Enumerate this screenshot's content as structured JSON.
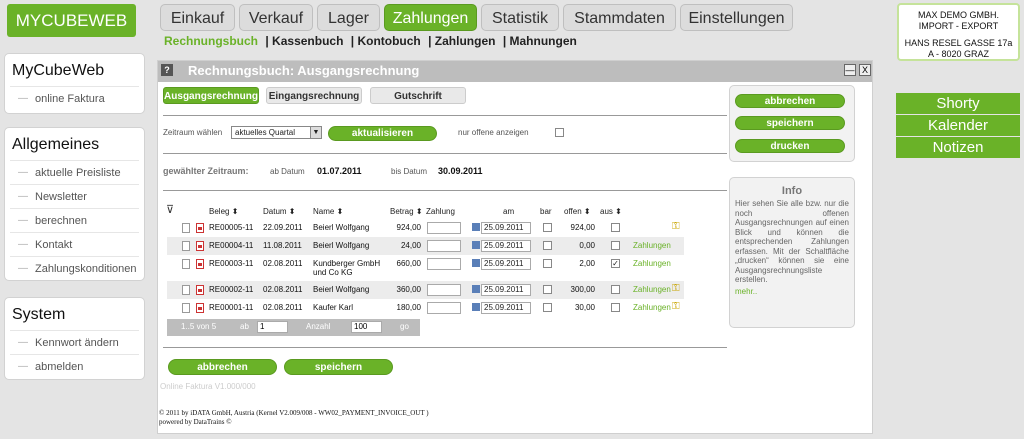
{
  "app": {
    "logo": "MYCUBEWEB"
  },
  "topnav": [
    "Einkauf",
    "Verkauf",
    "Lager",
    "Zahlungen",
    "Statistik",
    "Stammdaten",
    "Einstellungen"
  ],
  "subnav": [
    "Rechnungsbuch",
    "| Kassenbuch",
    "| Kontobuch",
    "| Zahlungen",
    "| Mahnungen"
  ],
  "sidebar": {
    "mycubeweb": {
      "title": "MyCubeWeb",
      "items": [
        "online Faktura"
      ]
    },
    "allgemeines": {
      "title": "Allgemeines",
      "items": [
        "aktuelle Preisliste",
        "Newsletter",
        "berechnen",
        "Kontakt",
        "Zahlungskonditionen"
      ]
    },
    "system": {
      "title": "System",
      "items": [
        "Kennwort ändern",
        "abmelden"
      ]
    }
  },
  "company": {
    "line1": "MAX DEMO GMBH.",
    "line2": "IMPORT - EXPORT",
    "line3": "HANS RESEL GASSE 17a",
    "line4": "A - 8020 GRAZ"
  },
  "rightnav": [
    "Shorty",
    "Kalender",
    "Notizen"
  ],
  "panel": {
    "icon": "?",
    "title": "Rechnungsbuch: Ausgangsrechnung",
    "min": "—",
    "close": "X",
    "tabs": [
      "Ausgangsrechnung",
      "Eingangsrechnung",
      "Gutschrift"
    ],
    "filter": {
      "label": "Zeitraum wählen",
      "select": "aktuelles Quartal",
      "refresh": "aktualisieren",
      "open_only": "nur offene anzeigen"
    },
    "period": {
      "label": "gewählter Zeitraum:",
      "from_label": "ab Datum",
      "from": "01.07.2011",
      "to_label": "bis Datum",
      "to": "30.09.2011"
    },
    "columns": [
      "Beleg",
      "Datum",
      "Name",
      "Betrag",
      "Zahlung",
      "am",
      "bar",
      "offen",
      "aus"
    ],
    "rows": [
      {
        "beleg": "RE00005-11",
        "datum": "22.09.2011",
        "name": "Beierl Wolfgang",
        "betrag": "924,00",
        "am": "25.09.2011",
        "offen": "924,00",
        "aus": false,
        "link": "",
        "key": true
      },
      {
        "beleg": "RE00004-11",
        "datum": "11.08.2011",
        "name": "Beierl Wolfgang",
        "betrag": "24,00",
        "am": "25.09.2011",
        "offen": "0,00",
        "aus": false,
        "link": "Zahlungen",
        "key": false
      },
      {
        "beleg": "RE00003-11",
        "datum": "02.08.2011",
        "name": "Kundberger GmbH und Co KG",
        "betrag": "660,00",
        "am": "25.09.2011",
        "offen": "2,00",
        "aus": true,
        "link": "Zahlungen",
        "key": false
      },
      {
        "beleg": "RE00002-11",
        "datum": "02.08.2011",
        "name": "Beierl Wolfgang",
        "betrag": "360,00",
        "am": "25.09.2011",
        "offen": "300,00",
        "aus": false,
        "link": "Zahlungen",
        "key": true
      },
      {
        "beleg": "RE00001-11",
        "datum": "02.08.2011",
        "name": "Kaufer Karl",
        "betrag": "180,00",
        "am": "25.09.2011",
        "offen": "30,00",
        "aus": false,
        "link": "Zahlungen",
        "key": true
      }
    ],
    "pager": {
      "range": "1..5 von 5",
      "ab_label": "ab",
      "ab": "1",
      "anzahl_label": "Anzahl",
      "anzahl": "100",
      "go": "go"
    },
    "actions": {
      "cancel": "abbrechen",
      "save": "speichern",
      "print": "drucken"
    },
    "info": {
      "title": "Info",
      "text": "Hier sehen Sie alle bzw. nur die noch offenen Ausgangsrechnungen auf einen Blick und können die entsprechenden Zahlungen erfassen. Mit der Schaltfläche „drucken“ können sie eine Ausgangsrechnungsliste erstellen.",
      "more": "mehr.."
    },
    "version": "Online Faktura V1.000/000",
    "footer1": "© 2011 by iDATA GmbH, Austria (Kernel V2.009/008 - WW02_PAYMENT_INVOICE_OUT )",
    "footer2": "powered by DataTrains ©"
  },
  "colors": {
    "accent": "#6ab228",
    "header": "#bdbdbd"
  }
}
